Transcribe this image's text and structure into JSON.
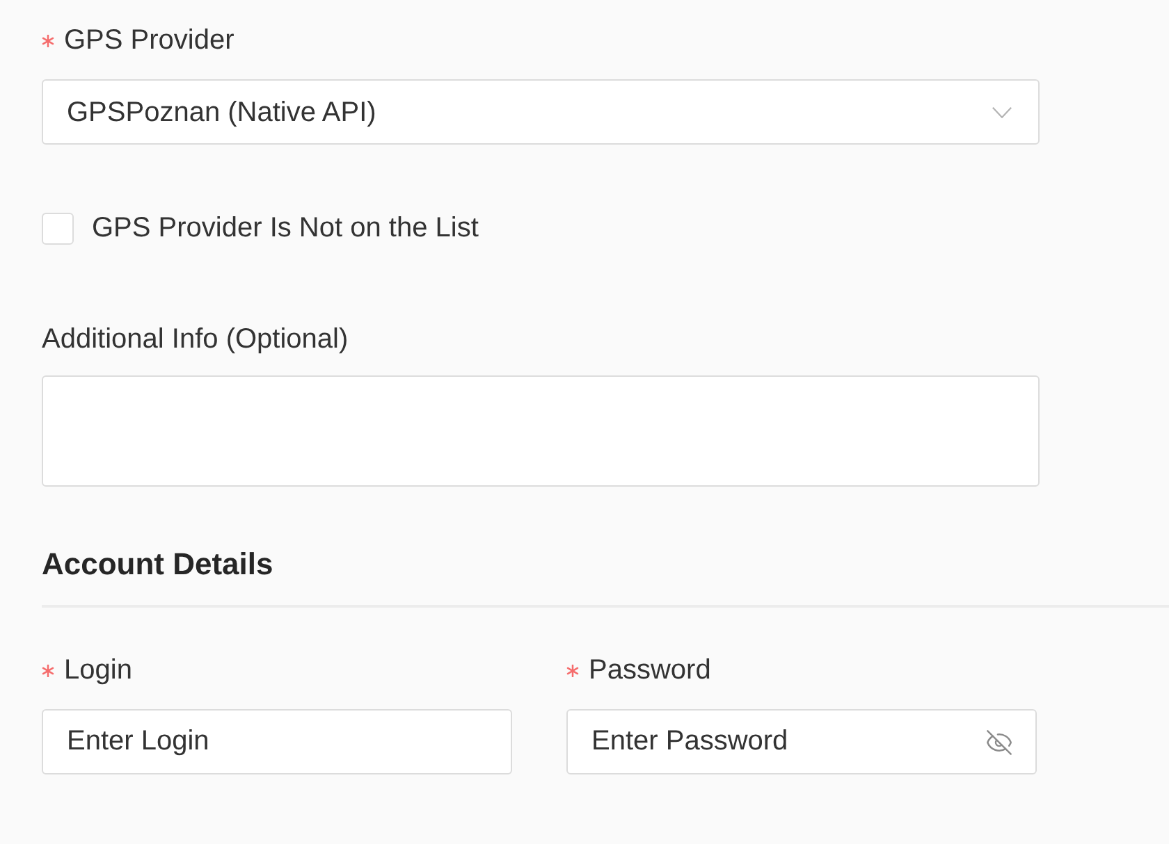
{
  "gps_provider": {
    "label": "GPS Provider",
    "required": true,
    "value": "GPSPoznan (Native API)"
  },
  "provider_not_listed": {
    "label": "GPS Provider Is Not on the List",
    "checked": false
  },
  "additional_info": {
    "label": "Additional Info (Optional)"
  },
  "account_details": {
    "title": "Account Details",
    "fields": [
      {
        "kind": "text",
        "label": "Login",
        "required": true,
        "placeholder": "Enter Login"
      },
      {
        "kind": "password",
        "label": "Password",
        "required": true,
        "placeholder": "Enter Password"
      }
    ]
  }
}
